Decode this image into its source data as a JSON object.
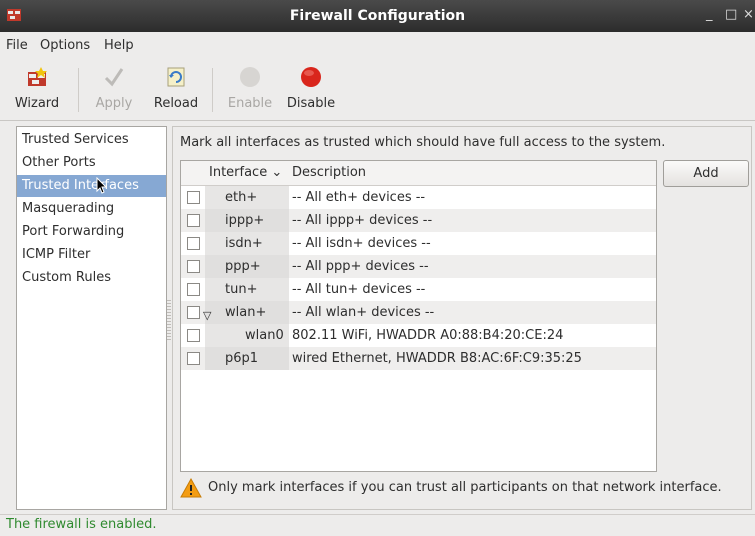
{
  "window": {
    "title": "Firewall Configuration"
  },
  "menu": {
    "file": "File",
    "options": "Options",
    "help": "Help"
  },
  "toolbar": {
    "wizard": "Wizard",
    "apply": "Apply",
    "reload": "Reload",
    "enable": "Enable",
    "disable": "Disable"
  },
  "sidebar": {
    "items": [
      {
        "label": "Trusted Services"
      },
      {
        "label": "Other Ports"
      },
      {
        "label": "Trusted Interfaces",
        "selected": true
      },
      {
        "label": "Masquerading"
      },
      {
        "label": "Port Forwarding"
      },
      {
        "label": "ICMP Filter"
      },
      {
        "label": "Custom Rules"
      }
    ]
  },
  "main": {
    "description": "Mark all interfaces as trusted which should have full access to the system.",
    "columns": {
      "interface": "Interface",
      "description": "Description"
    },
    "rows": [
      {
        "interface": "eth+",
        "description": "-- All eth+ devices --"
      },
      {
        "interface": "ippp+",
        "description": "-- All ippp+ devices --"
      },
      {
        "interface": "isdn+",
        "description": "-- All isdn+ devices --"
      },
      {
        "interface": "ppp+",
        "description": "-- All ppp+ devices --"
      },
      {
        "interface": "tun+",
        "description": "-- All tun+ devices --"
      },
      {
        "interface": "wlan+",
        "description": "-- All wlan+ devices --"
      },
      {
        "interface": "wlan0",
        "description": "802.11 WiFi, HWADDR A0:88:B4:20:CE:24"
      },
      {
        "interface": "p6p1",
        "description": "wired Ethernet, HWADDR B8:AC:6F:C9:35:25"
      }
    ],
    "add_label": "Add",
    "warning": "Only mark interfaces if you can trust all participants on that network interface."
  },
  "status": "The firewall is enabled.",
  "colors": {
    "selection": "#86a8d3",
    "status_text": "#2f8a2f",
    "disable_icon": "#d9261c"
  }
}
